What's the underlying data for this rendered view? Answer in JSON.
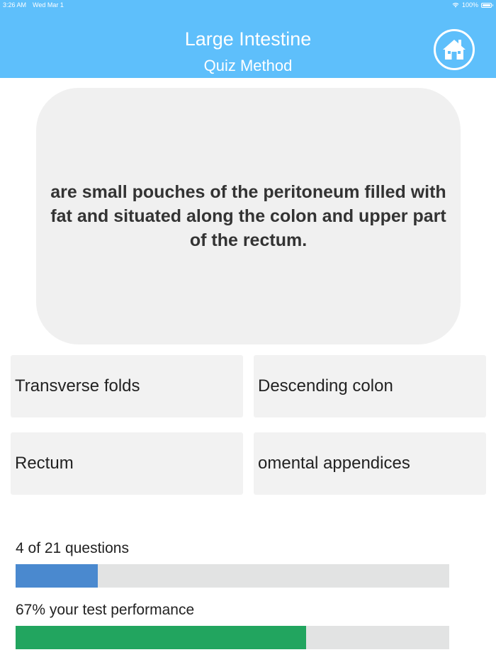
{
  "status_bar": {
    "time": "3:26 AM",
    "date": "Wed Mar 1",
    "battery": "100%"
  },
  "header": {
    "title": "Large Intestine",
    "subtitle": "Quiz Method",
    "home_icon": "home-icon",
    "background_color": "#5ebffb"
  },
  "question": {
    "text": "are small pouches of the peritoneum filled with fat and situated along the colon and upper part of the rectum."
  },
  "answers": [
    "Transverse folds",
    "Descending colon",
    "Rectum",
    "omental appendices"
  ],
  "progress": {
    "questions_label": "4 of 21 questions",
    "questions_fraction": 0.19,
    "questions_color": "#4a89cf",
    "performance_label": "67% your test performance",
    "performance_fraction": 0.67,
    "performance_color": "#22a55f"
  }
}
